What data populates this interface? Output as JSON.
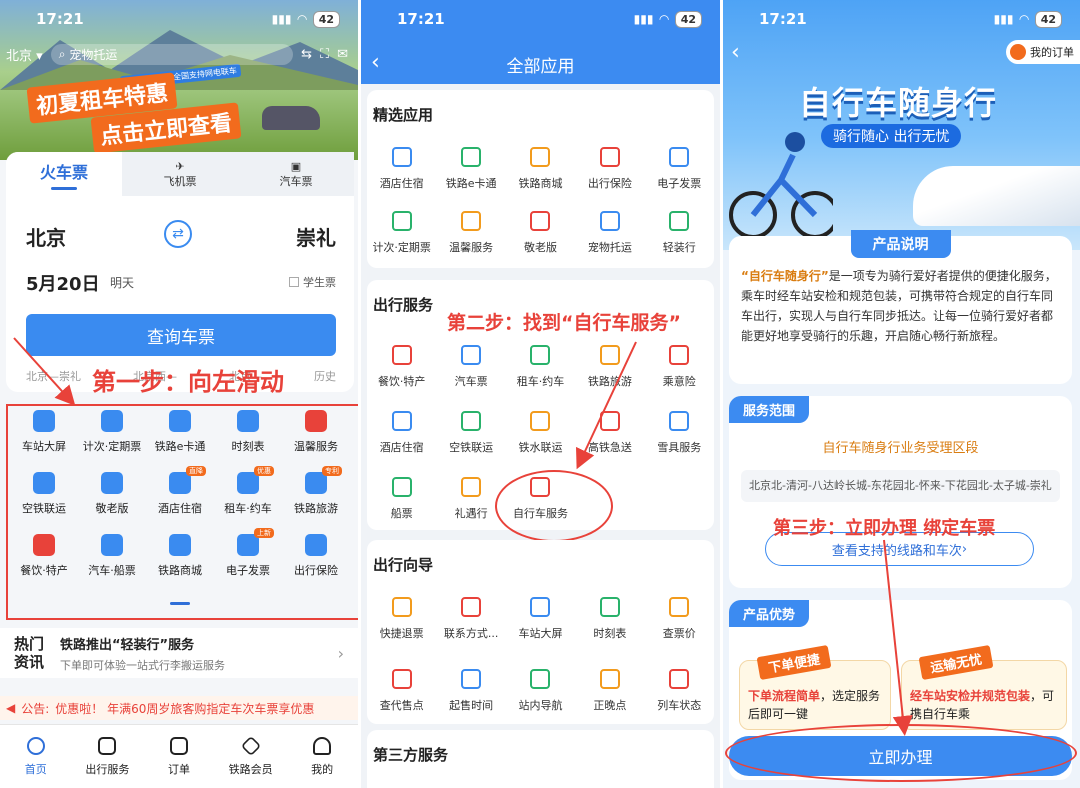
{
  "status": {
    "time": "17:21",
    "battery": "42"
  },
  "p1": {
    "city": "北京",
    "pet": "宠物托运",
    "promo_small": "12306开售 · 全国支持网电联车",
    "promo_line1": "初夏租车特惠",
    "promo_line2": "点击立即查看",
    "tabs": [
      "火车票",
      "飞机票",
      "汽车票"
    ],
    "from": "北京",
    "to": "崇礼",
    "date": "5月20日",
    "day": "明天",
    "student": "学生票",
    "query": "查询车票",
    "history": [
      "北京—崇礼",
      "北京西—",
      "北京—",
      "历史"
    ],
    "annotation": "第一步：向左滑动",
    "grid": [
      {
        "label": "车站大屏",
        "tag": ""
      },
      {
        "label": "计次·定期票",
        "tag": ""
      },
      {
        "label": "铁路e卡通",
        "tag": ""
      },
      {
        "label": "时刻表",
        "tag": ""
      },
      {
        "label": "温馨服务",
        "tag": ""
      },
      {
        "label": "空铁联运",
        "tag": ""
      },
      {
        "label": "敬老版",
        "tag": ""
      },
      {
        "label": "酒店住宿",
        "tag": "直降"
      },
      {
        "label": "租车·约车",
        "tag": "优惠"
      },
      {
        "label": "铁路旅游",
        "tag": "专利"
      },
      {
        "label": "餐饮·特产",
        "tag": ""
      },
      {
        "label": "汽车·船票",
        "tag": ""
      },
      {
        "label": "铁路商城",
        "tag": ""
      },
      {
        "label": "电子发票",
        "tag": "上新"
      },
      {
        "label": "出行保险",
        "tag": ""
      }
    ],
    "news_head": "热门资讯",
    "news_title": "铁路推出“轻装行”服务",
    "news_sub": "下单即可体验一站式行李搬运服务",
    "notice_label": "公告:",
    "notice_text": "优惠啦！ 年满60周岁旅客购指定车次车票享优惠",
    "tabbar": [
      "首页",
      "出行服务",
      "订单",
      "铁路会员",
      "我的"
    ]
  },
  "p2": {
    "title": "全部应用",
    "annotation": "第二步：找到“自行车服务”",
    "sections": [
      {
        "title": "精选应用",
        "items": [
          "酒店住宿",
          "铁路e卡通",
          "铁路商城",
          "出行保险",
          "电子发票",
          "计次·定期票",
          "温馨服务",
          "敬老版",
          "宠物托运",
          "轻装行"
        ]
      },
      {
        "title": "出行服务",
        "items": [
          "餐饮·特产",
          "汽车票",
          "租车·约车",
          "铁路旅游",
          "乘意险",
          "酒店住宿",
          "空铁联运",
          "铁水联运",
          "高铁急送",
          "雪具服务",
          "船票",
          "礼遇行",
          "自行车服务"
        ]
      },
      {
        "title": "出行向导",
        "items": [
          "快捷退票",
          "联系方式...",
          "车站大屏",
          "时刻表",
          "查票价",
          "查代售点",
          "起售时间",
          "站内导航",
          "正晚点",
          "列车状态"
        ]
      },
      {
        "title": "第三方服务",
        "items": []
      }
    ]
  },
  "p3": {
    "my_orders": "我的订单",
    "hero_title": "自行车随身行",
    "hero_sub": "骑行随心 出行无忧",
    "desc_title": "产品说明",
    "desc_hl": "“自行车随身行”",
    "desc_body": "是一项专为骑行爱好者提供的便捷化服务，乘车时经车站安检和规范包装，可携带符合规定的自行车同车出行，实现人与自行车同步抵达。让每一位骑行爱好者都能更好地享受骑行的乐趣，开启随心畅行新旅程。",
    "scope_title": "服务范围",
    "scope_sub": "自行车随身行业务受理区段",
    "scope_route": "北京北-清河-八达岭长城-东花园北-怀来-下花园北-太子城-崇礼",
    "annotation": "第三步：立即办理 绑定车票",
    "scope_btn": "查看支持的线路和车次",
    "adv_title": "产品优势",
    "adv": [
      {
        "tag": "下单便捷",
        "hl": "下单流程简单",
        "body": "，选定服务后即可一键"
      },
      {
        "tag": "运输无忧",
        "hl": "经车站安检并规范包装",
        "body": "，可携自行车乘"
      }
    ],
    "go": "立即办理"
  }
}
